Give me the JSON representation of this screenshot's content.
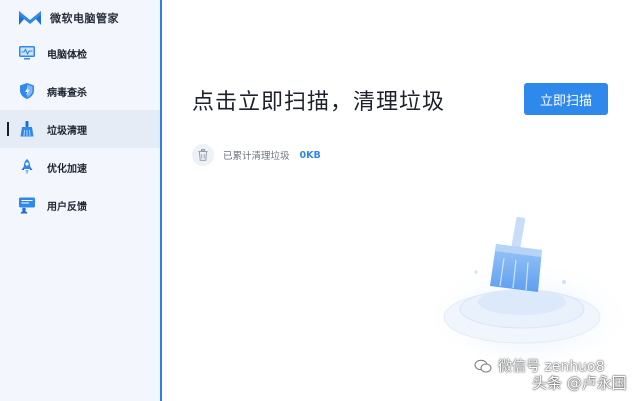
{
  "app": {
    "title": "微软电脑管家",
    "accent_color": "#2f88ec",
    "logo_icon": "ms-pc-manager-logo"
  },
  "sidebar": {
    "items": [
      {
        "label": "电脑体检",
        "icon": "monitor-check-icon",
        "active": false
      },
      {
        "label": "病毒查杀",
        "icon": "shield-icon",
        "active": false
      },
      {
        "label": "垃圾清理",
        "icon": "broom-icon",
        "active": true
      },
      {
        "label": "优化加速",
        "icon": "rocket-icon",
        "active": false
      },
      {
        "label": "用户反馈",
        "icon": "feedback-icon",
        "active": false
      }
    ]
  },
  "window_controls": {
    "minimize_icon": "minimize-icon",
    "menu_icon": "menu-icon",
    "close_icon": "close-icon"
  },
  "main": {
    "headline": "点击立即扫描，清理垃圾",
    "scan_button_label": "立即扫描",
    "stats": {
      "label": "已累计清理垃圾",
      "value": "0KB",
      "icon": "trash-icon"
    }
  },
  "watermark": {
    "line1": "微信号 zenhuo8",
    "line2": "头条 @卢永国"
  }
}
